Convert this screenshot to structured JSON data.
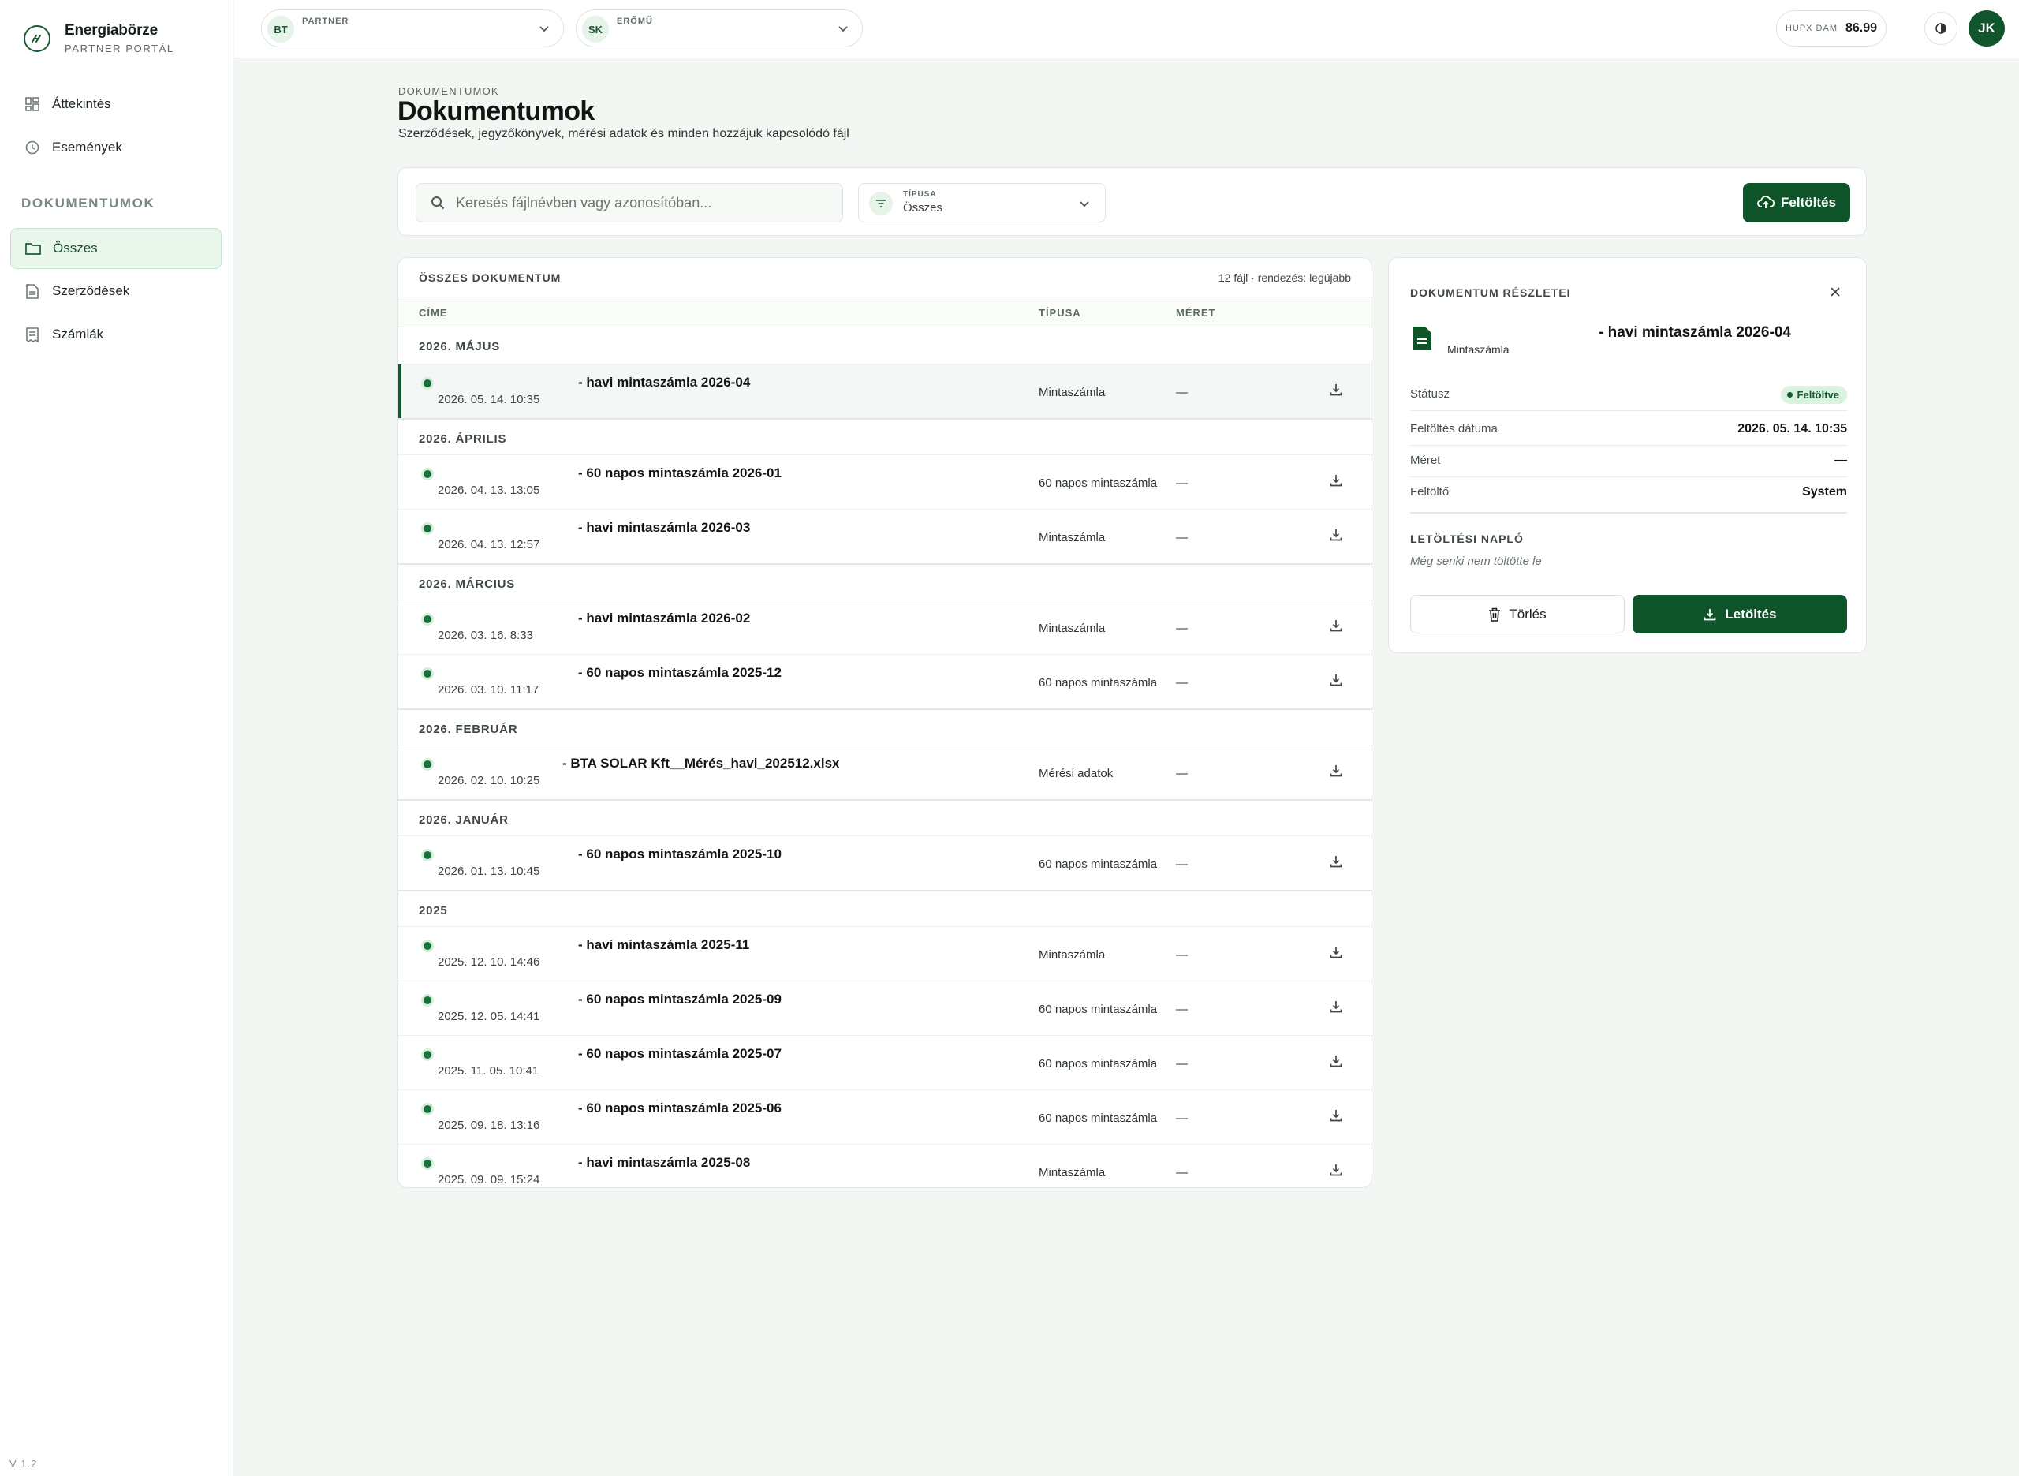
{
  "brand": {
    "name": "Energiabörze",
    "subtitle": "PARTNER PORTÁL"
  },
  "sidebar": {
    "items": [
      {
        "label": "Áttekintés",
        "icon": "dashboard-icon"
      },
      {
        "label": "Események",
        "icon": "history-icon"
      }
    ],
    "section_label": "DOKUMENTUMOK",
    "doc_items": [
      {
        "label": "Összes",
        "icon": "folder-icon",
        "active": true
      },
      {
        "label": "Szerződések",
        "icon": "document-icon"
      },
      {
        "label": "Számlák",
        "icon": "receipt-icon"
      }
    ],
    "version": "V 1.2"
  },
  "topbar": {
    "partner": {
      "initials": "BT",
      "label": "PARTNER"
    },
    "plant": {
      "initials": "SK",
      "label": "ERŐMŰ"
    },
    "price_label": "HUPX DAM",
    "price_value": "86.99",
    "user_initials": "JK"
  },
  "header": {
    "breadcrumb": "DOKUMENTUMOK",
    "title": "Dokumentumok",
    "subtitle": "Szerződések, jegyzőkönyvek, mérési adatok és minden hozzájuk kapcsolódó fájl"
  },
  "filters": {
    "search_placeholder": "Keresés fájlnévben vagy azonosítóban...",
    "type_label": "TÍPUSA",
    "type_value": "Összes",
    "upload_label": "Feltöltés"
  },
  "list": {
    "title": "ÖSSZES DOKUMENTUM",
    "meta": "12 fájl · rendezés: legújabb",
    "columns": {
      "title": "CÍME",
      "type": "TÍPUSA",
      "size": "MÉRET"
    },
    "groups": [
      {
        "label": "2026. MÁJUS",
        "rows": [
          {
            "title": "- havi mintaszámla 2026-04",
            "date": "2026. 05. 14. 10:35",
            "type": "Mintaszámla",
            "size": "—",
            "selected": true
          }
        ]
      },
      {
        "label": "2026. ÁPRILIS",
        "rows": [
          {
            "title": "- 60 napos mintaszámla 2026-01",
            "date": "2026. 04. 13. 13:05",
            "type": "60 napos mintaszámla",
            "size": "—"
          },
          {
            "title": "- havi mintaszámla 2026-03",
            "date": "2026. 04. 13. 12:57",
            "type": "Mintaszámla",
            "size": "—"
          }
        ]
      },
      {
        "label": "2026. MÁRCIUS",
        "rows": [
          {
            "title": "- havi mintaszámla 2026-02",
            "date": "2026. 03. 16. 8:33",
            "type": "Mintaszámla",
            "size": "—"
          },
          {
            "title": "- 60 napos mintaszámla 2025-12",
            "date": "2026. 03. 10. 11:17",
            "type": "60 napos mintaszámla",
            "size": "—"
          }
        ]
      },
      {
        "label": "2026. FEBRUÁR",
        "rows": [
          {
            "title": "- BTA SOLAR Kft__Mérés_havi_202512.xlsx",
            "date": "2026. 02. 10. 10:25",
            "type": "Mérési adatok",
            "size": "—",
            "wide": true
          }
        ]
      },
      {
        "label": "2026. JANUÁR",
        "rows": [
          {
            "title": "- 60 napos mintaszámla 2025-10",
            "date": "2026. 01. 13. 10:45",
            "type": "60 napos mintaszámla",
            "size": "—"
          }
        ]
      },
      {
        "label": "2025",
        "rows": [
          {
            "title": "- havi mintaszámla 2025-11",
            "date": "2025. 12. 10. 14:46",
            "type": "Mintaszámla",
            "size": "—"
          },
          {
            "title": "- 60 napos mintaszámla 2025-09",
            "date": "2025. 12. 05. 14:41",
            "type": "60 napos mintaszámla",
            "size": "—"
          },
          {
            "title": "- 60 napos mintaszámla 2025-07",
            "date": "2025. 11. 05. 10:41",
            "type": "60 napos mintaszámla",
            "size": "—"
          },
          {
            "title": "- 60 napos mintaszámla 2025-06",
            "date": "2025. 09. 18. 13:16",
            "type": "60 napos mintaszámla",
            "size": "—"
          },
          {
            "title": "- havi mintaszámla 2025-08",
            "date": "2025. 09. 09. 15:24",
            "type": "Mintaszámla",
            "size": "—"
          }
        ]
      }
    ]
  },
  "details": {
    "heading": "DOKUMENTUM RÉSZLETEI",
    "title": "- havi mintaszámla 2026-04",
    "type": "Mintaszámla",
    "status_label": "Státusz",
    "status_value": "Feltöltve",
    "upload_date_label": "Feltöltés dátuma",
    "upload_date_value": "2026. 05. 14. 10:35",
    "size_label": "Méret",
    "size_value": "—",
    "uploader_label": "Feltöltő",
    "uploader_value": "System",
    "log_heading": "LETÖLTÉSI NAPLÓ",
    "log_empty": "Még senki nem töltötte le",
    "delete_label": "Törlés",
    "download_label": "Letöltés"
  },
  "colors": {
    "accent": "#0f5329",
    "accent_light": "#e9f6ec",
    "status_green": "#17713a"
  }
}
